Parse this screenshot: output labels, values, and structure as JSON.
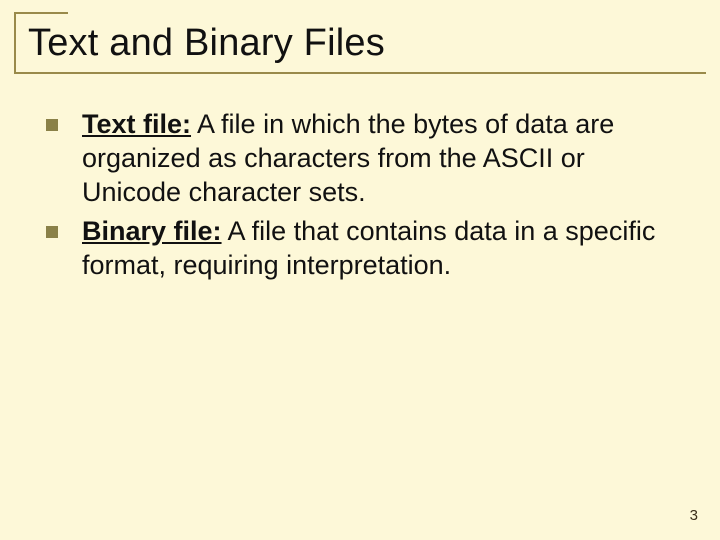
{
  "title": "Text and Binary Files",
  "bullets": [
    {
      "term": "Text file:",
      "definition": "   A file in which the bytes of data are organized as characters from the ASCII or Unicode character sets."
    },
    {
      "term": "Binary file:",
      "definition": "  A file that contains data in a specific format, requiring interpretation."
    }
  ],
  "page_number": "3"
}
